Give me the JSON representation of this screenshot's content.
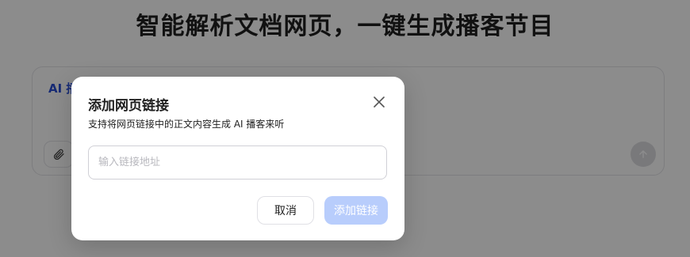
{
  "page": {
    "headline": "智能解析文档网页，一键生成播客节目"
  },
  "composer": {
    "prefix_label": "AI 播",
    "attach_icon": "paperclip-icon",
    "send_icon": "arrow-up-icon"
  },
  "dialog": {
    "title": "添加网页链接",
    "subtitle": "支持将网页链接中的正文内容生成 AI 播客来听",
    "input_placeholder": "输入链接地址",
    "cancel_label": "取消",
    "submit_label": "添加链接",
    "close_icon": "close-icon"
  },
  "colors": {
    "overlay": "rgba(0,0,0,0.45)",
    "submit_disabled": "#b8cdfc",
    "accent_text": "#2a4fd6"
  }
}
